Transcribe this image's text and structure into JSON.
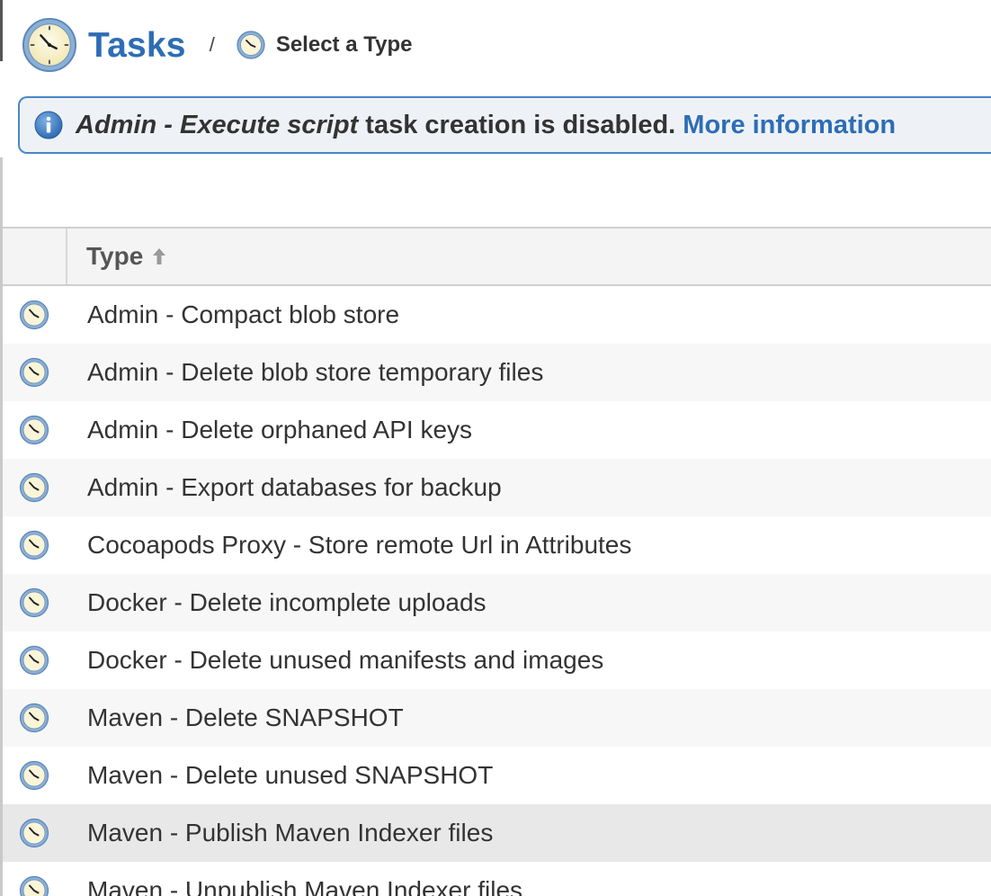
{
  "header": {
    "title": "Tasks",
    "separator": "/",
    "breadcrumb_current": "Select a Type"
  },
  "banner": {
    "emphasis": "Admin - Execute script",
    "message": " task creation is disabled. ",
    "link": "More information"
  },
  "table": {
    "column_header": "Type",
    "sort": "ascending",
    "rows": [
      {
        "label": "Admin - Compact blob store"
      },
      {
        "label": "Admin - Delete blob store temporary files"
      },
      {
        "label": "Admin - Delete orphaned API keys"
      },
      {
        "label": "Admin - Export databases for backup"
      },
      {
        "label": "Cocoapods Proxy - Store remote Url in Attributes"
      },
      {
        "label": "Docker - Delete incomplete uploads"
      },
      {
        "label": "Docker - Delete unused manifests and images"
      },
      {
        "label": "Maven - Delete SNAPSHOT"
      },
      {
        "label": "Maven - Delete unused SNAPSHOT"
      },
      {
        "label": "Maven - Publish Maven Indexer files"
      },
      {
        "label": "Maven - Unpublish Maven Indexer files"
      }
    ]
  },
  "colors": {
    "accent": "#2e6db5",
    "banner_border": "#4a86c8",
    "banner_bg": "#eef2f7",
    "selected_row": "#e8e8e8"
  },
  "icons": {
    "header": "clock-icon",
    "breadcrumb": "clock-icon",
    "banner": "info-icon",
    "sort": "arrow-up-icon",
    "row": "clock-icon"
  }
}
